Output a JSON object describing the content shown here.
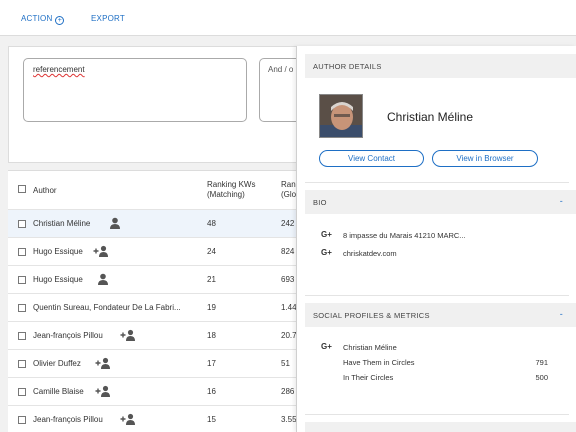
{
  "toolbar": {
    "action_label": "ACTION",
    "export_label": "EXPORT"
  },
  "search": {
    "keyword_value": "referencement",
    "second_placeholder": "And / o"
  },
  "table": {
    "headers": {
      "author": "Author",
      "rank_line1": "Ranking KWs",
      "rank_line2": "(Matching)",
      "rank2_line1": "Ran",
      "rank2_line2": "(Glo"
    },
    "rows": [
      {
        "name": "Christian Méline",
        "v1": "48",
        "v2": "242",
        "icon": "person-icon"
      },
      {
        "name": "Hugo Essique",
        "v1": "24",
        "v2": "824",
        "icon": "add-person-icon"
      },
      {
        "name": "Hugo Essique",
        "v1": "21",
        "v2": "693",
        "icon": "person-icon"
      },
      {
        "name": "Quentin Sureau, Fondateur De La Fabri...",
        "v1": "19",
        "v2": "1.44",
        "icon": ""
      },
      {
        "name": "Jean-françois Pillou",
        "v1": "18",
        "v2": "20.7",
        "icon": "add-person-icon"
      },
      {
        "name": "Olivier Duffez",
        "v1": "17",
        "v2": "51",
        "icon": "add-person-icon"
      },
      {
        "name": "Camille Blaise",
        "v1": "16",
        "v2": "286",
        "icon": "add-person-icon"
      },
      {
        "name": "Jean-françois Pillou",
        "v1": "15",
        "v2": "3.55",
        "icon": "add-person-icon"
      }
    ]
  },
  "panel": {
    "details_title": "AUTHOR DETAILS",
    "author_name": "Christian Méline",
    "view_contact": "View Contact",
    "view_browser": "View in Browser",
    "bio_title": "BIO",
    "bio_dash": "-",
    "bio_lines": [
      "8 impasse du Marais 41210 MARC...",
      "chriskatdev.com"
    ],
    "social_title": "SOCIAL PROFILES & METRICS",
    "social_dash": "-",
    "social_name": "Christian Méline",
    "metrics": [
      {
        "label": "Have Them in Circles",
        "value": "791"
      },
      {
        "label": "In Their Circles",
        "value": "500"
      }
    ],
    "gplus": "G+"
  },
  "colors": {
    "accent": "#1e6fc5",
    "selected_row": "#eef4fb",
    "section_bg": "#f0f0f0"
  }
}
